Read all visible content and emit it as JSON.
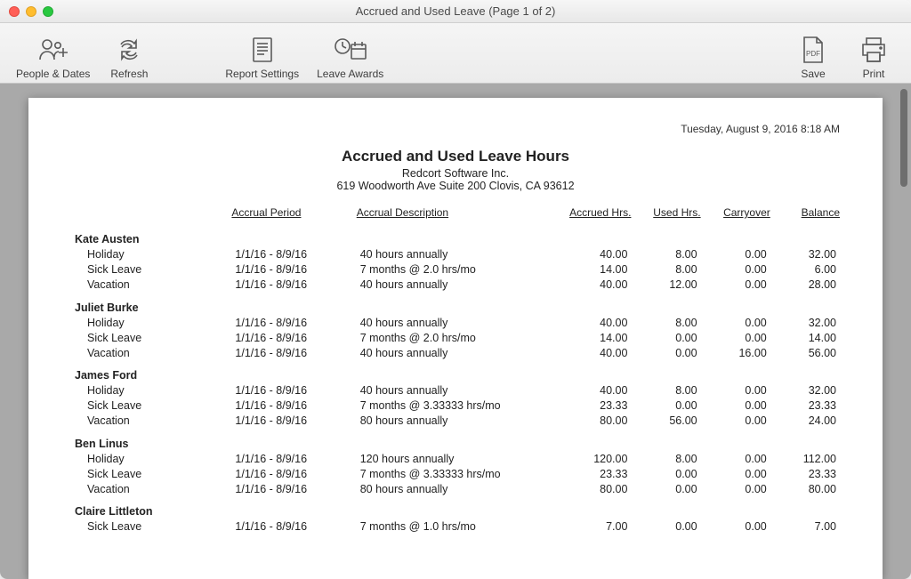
{
  "window": {
    "title": "Accrued and Used Leave  (Page 1 of 2)"
  },
  "toolbar": {
    "people_dates": "People & Dates",
    "refresh": "Refresh",
    "report_settings": "Report Settings",
    "leave_awards": "Leave Awards",
    "save": "Save",
    "print": "Print",
    "pdf_badge": "PDF"
  },
  "report": {
    "timestamp": "Tuesday, August 9, 2016  8:18 AM",
    "title": "Accrued and Used Leave Hours",
    "company": "Redcort Software Inc.",
    "address": "619 Woodworth Ave Suite 200  Clovis, CA 93612",
    "headers": {
      "period": "Accrual Period",
      "desc": "Accrual Description",
      "accrued": "Accrued Hrs.",
      "used": "Used Hrs.",
      "carryover": "Carryover",
      "balance": "Balance"
    },
    "employees": [
      {
        "name": "Kate Austen",
        "rows": [
          {
            "cat": "Holiday",
            "period": "1/1/16 - 8/9/16",
            "desc": "40 hours annually",
            "accrued": "40.00",
            "used": "8.00",
            "carryover": "0.00",
            "balance": "32.00"
          },
          {
            "cat": "Sick Leave",
            "period": "1/1/16 - 8/9/16",
            "desc": "7 months @ 2.0 hrs/mo",
            "accrued": "14.00",
            "used": "8.00",
            "carryover": "0.00",
            "balance": "6.00"
          },
          {
            "cat": "Vacation",
            "period": "1/1/16 - 8/9/16",
            "desc": "40 hours annually",
            "accrued": "40.00",
            "used": "12.00",
            "carryover": "0.00",
            "balance": "28.00"
          }
        ]
      },
      {
        "name": "Juliet Burke",
        "rows": [
          {
            "cat": "Holiday",
            "period": "1/1/16 - 8/9/16",
            "desc": "40 hours annually",
            "accrued": "40.00",
            "used": "8.00",
            "carryover": "0.00",
            "balance": "32.00"
          },
          {
            "cat": "Sick Leave",
            "period": "1/1/16 - 8/9/16",
            "desc": "7 months @ 2.0 hrs/mo",
            "accrued": "14.00",
            "used": "0.00",
            "carryover": "0.00",
            "balance": "14.00"
          },
          {
            "cat": "Vacation",
            "period": "1/1/16 - 8/9/16",
            "desc": "40 hours annually",
            "accrued": "40.00",
            "used": "0.00",
            "carryover": "16.00",
            "balance": "56.00"
          }
        ]
      },
      {
        "name": "James Ford",
        "rows": [
          {
            "cat": "Holiday",
            "period": "1/1/16 - 8/9/16",
            "desc": "40 hours annually",
            "accrued": "40.00",
            "used": "8.00",
            "carryover": "0.00",
            "balance": "32.00"
          },
          {
            "cat": "Sick Leave",
            "period": "1/1/16 - 8/9/16",
            "desc": "7 months @ 3.33333 hrs/mo",
            "accrued": "23.33",
            "used": "0.00",
            "carryover": "0.00",
            "balance": "23.33"
          },
          {
            "cat": "Vacation",
            "period": "1/1/16 - 8/9/16",
            "desc": "80 hours annually",
            "accrued": "80.00",
            "used": "56.00",
            "carryover": "0.00",
            "balance": "24.00"
          }
        ]
      },
      {
        "name": "Ben Linus",
        "rows": [
          {
            "cat": "Holiday",
            "period": "1/1/16 - 8/9/16",
            "desc": "120 hours annually",
            "accrued": "120.00",
            "used": "8.00",
            "carryover": "0.00",
            "balance": "112.00"
          },
          {
            "cat": "Sick Leave",
            "period": "1/1/16 - 8/9/16",
            "desc": "7 months @ 3.33333 hrs/mo",
            "accrued": "23.33",
            "used": "0.00",
            "carryover": "0.00",
            "balance": "23.33"
          },
          {
            "cat": "Vacation",
            "period": "1/1/16 - 8/9/16",
            "desc": "80 hours annually",
            "accrued": "80.00",
            "used": "0.00",
            "carryover": "0.00",
            "balance": "80.00"
          }
        ]
      },
      {
        "name": "Claire Littleton",
        "rows": [
          {
            "cat": "Sick Leave",
            "period": "1/1/16 - 8/9/16",
            "desc": "7 months @ 1.0 hrs/mo",
            "accrued": "7.00",
            "used": "0.00",
            "carryover": "0.00",
            "balance": "7.00"
          }
        ]
      }
    ]
  }
}
